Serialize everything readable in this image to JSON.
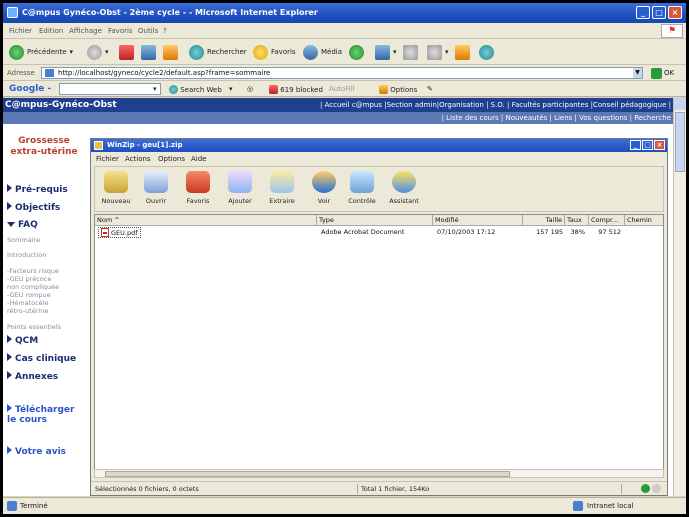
{
  "browser": {
    "title": "C@mpus Gynéco-Obst - 2ème cycle - - Microsoft Internet Explorer",
    "window_buttons": [
      "_",
      "□",
      "×"
    ],
    "menu": [
      "Fichier",
      "Edition",
      "Affichage",
      "Favoris",
      "Outils",
      "?"
    ],
    "toolbar": {
      "back": "Précédente",
      "search": "Rechercher",
      "favorites": "Favoris",
      "media": "Média"
    },
    "address_label": "Adresse",
    "address_value": "http://localhost/gyneco/cycle2/default.asp?frame=sommaire",
    "go_label": "OK",
    "googlebar": {
      "logo": "Google -",
      "search_web": "Search Web",
      "blocked": "619 blocked",
      "autofill": "AutoFill",
      "options": "Options"
    },
    "status_left": "Terminé",
    "status_right": "Intranet local"
  },
  "site": {
    "brand": "C@mpus-Gynéco-Obst",
    "top_links": "| Accueil c@mpus |Section admin|Organisation | S.O. | Facultés participantes |Conseil pédagogique |",
    "sub_links": "| Liste des cours | Nouveautés | Liens | Vos questions | Recherche"
  },
  "sidebar": {
    "title_line1": "Grossesse",
    "title_line2": "extra-utérine",
    "items": [
      {
        "label": "Pré-requis"
      },
      {
        "label": "Objectifs"
      },
      {
        "label": "FAQ"
      }
    ],
    "faq_sub": [
      "Sommaire",
      "Introduction"
    ],
    "faq_details": [
      "-Facteurs risque",
      "-GEU précoce",
      "non compliquée",
      "-GEU rompue",
      "-Hématocèle",
      "rétro-utérine"
    ],
    "points": "Points essentiels",
    "items2": [
      {
        "label": "QCM"
      },
      {
        "label": "Cas clinique"
      },
      {
        "label": "Annexes"
      }
    ],
    "download_line1": "Télécharger",
    "download_line2": "le cours",
    "feedback": "Votre avis"
  },
  "winzip": {
    "title": "WinZip - geu[1].zip",
    "menu": [
      "Fichier",
      "Actions",
      "Options",
      "Aide"
    ],
    "tools": [
      "Nouveau",
      "Ouvrir",
      "Favoris",
      "Ajouter",
      "Extraire",
      "Voir",
      "Contrôle",
      "Assistant"
    ],
    "columns": [
      "Nom",
      "Type",
      "Modifié",
      "Taille",
      "Taux",
      "Compr...",
      "Chemin"
    ],
    "rows": [
      {
        "name": "GEU.pdf",
        "type": "Adobe Acrobat Document",
        "modified": "07/10/2003 17:12",
        "size": "157 195",
        "ratio": "38%",
        "compressed": "97 512",
        "path": ""
      }
    ],
    "status_left": "Sélectionnés 0 fichiers, 0 octets",
    "status_right": "Total 1 fichier, 154Ko"
  }
}
